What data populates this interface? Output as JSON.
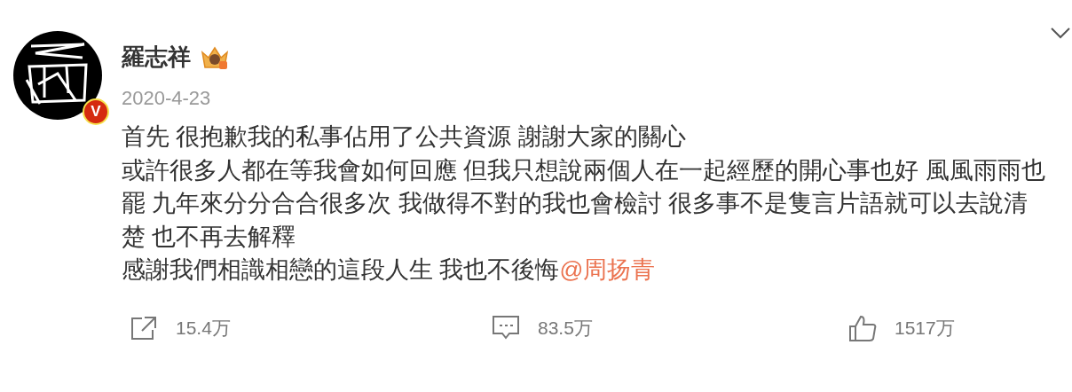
{
  "author": {
    "name": "羅志祥",
    "verified_badge": "V",
    "date": "2020-4-23"
  },
  "content": [
    {
      "text": "首先 很抱歉我的私事佔用了公共資源 謝謝大家的關心"
    },
    {
      "text": "或許很多人都在等我會如何回應 但我只想說兩個人在一起經歷的開心事也好 風風雨雨也"
    },
    {
      "text": "罷 九年來分分合合很多次 我做得不對的我也會檢討 很多事不是隻言片語就可以去說清"
    },
    {
      "text": "楚 也不再去解釋"
    },
    {
      "text": "感謝我們相識相戀的這段人生 我也不後悔",
      "mention": "@周扬青"
    }
  ],
  "actions": [
    {
      "kind": "share",
      "count": "15.4万"
    },
    {
      "kind": "comment",
      "count": "83.5万"
    },
    {
      "kind": "like",
      "count": "1517万"
    }
  ]
}
